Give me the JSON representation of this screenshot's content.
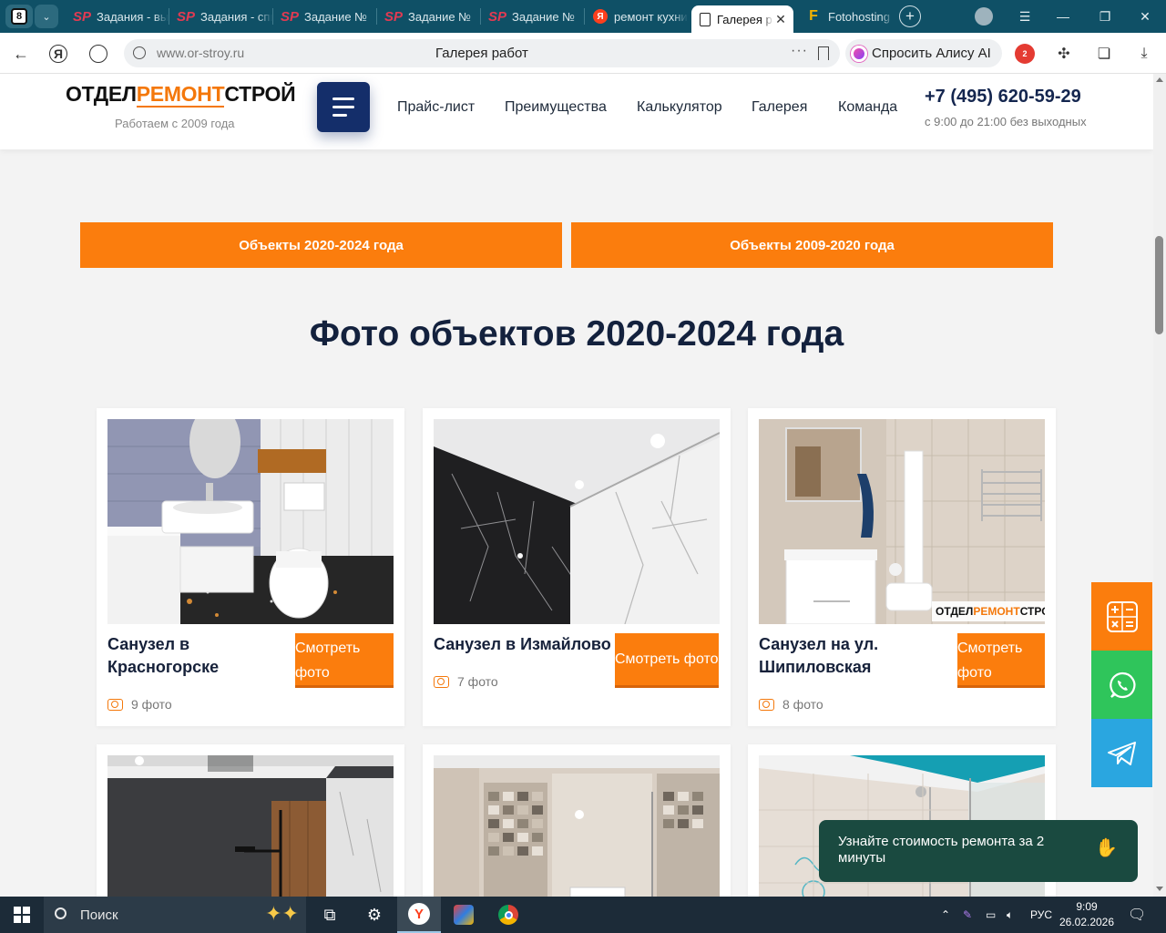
{
  "browser": {
    "tab_count": "8",
    "tabs": [
      {
        "title": "Задания - выполнение",
        "favicon": "sp"
      },
      {
        "title": "Задания - список",
        "favicon": "sp"
      },
      {
        "title": "Задание №",
        "favicon": "sp"
      },
      {
        "title": "Задание №",
        "favicon": "sp"
      },
      {
        "title": "Задание №",
        "favicon": "sp"
      },
      {
        "title": "ремонт кухни",
        "favicon": "yandex"
      },
      {
        "title": "Галерея работ",
        "favicon": "document",
        "active": true
      },
      {
        "title": "Fotohosting",
        "favicon": "fotohosting"
      }
    ],
    "address": {
      "url": "www.or-stroy.ru",
      "page_title": "Галерея работ",
      "alice_label": "Спросить Алису AI"
    },
    "extension_badge": "2"
  },
  "site": {
    "logo": {
      "left": "ОТДЕЛ",
      "middle": "РЕМОНТ",
      "right": "СТРОЙ",
      "subtitle": "Работаем с 2009 года"
    },
    "nav": [
      "Прайс-лист",
      "Преимущества",
      "Калькулятор",
      "Галерея",
      "Команда"
    ],
    "phone": "+7 (495) 620-59-29",
    "hours": "с 9:00 до 21:00 без выходных",
    "accent_color": "#fb7d0d",
    "navy_color": "#142e6a"
  },
  "gallery": {
    "buttons": [
      "Объекты 2020-2024 года",
      "Объекты 2009-2020 года"
    ],
    "title": "Фото объектов 2020-2024 года",
    "view_label": "Смотреть фото",
    "cards": [
      {
        "title": "Санузел в Красногорске",
        "count": "9 фото"
      },
      {
        "title": "Санузел в Измайлово",
        "count": "7 фото"
      },
      {
        "title": "Санузел на ул. Шипиловская",
        "count": "8 фото"
      }
    ],
    "watermark": "ОТДЕЛРЕМОНТСТРОЙ"
  },
  "widgets": {
    "calculator_color": "#fb7d0d",
    "whatsapp_color": "#2fc55b",
    "telegram_color": "#2aa6e0",
    "chat_popup": "Узнайте стоимость ремонта за 2 минуты"
  },
  "taskbar": {
    "search_label": "Поиск",
    "language": "РУС",
    "time": "9:09",
    "date": "26.02.2026"
  }
}
